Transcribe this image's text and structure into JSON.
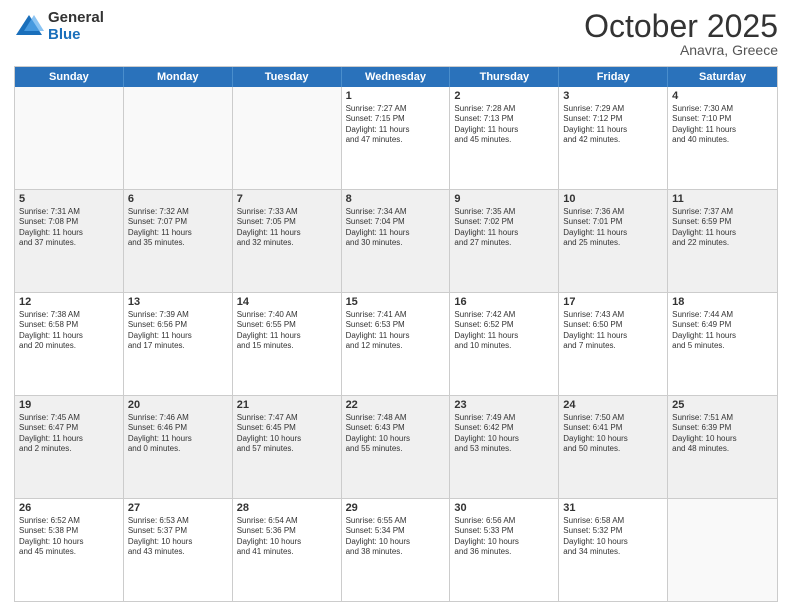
{
  "header": {
    "logo_line1": "General",
    "logo_line2": "Blue",
    "month": "October 2025",
    "location": "Anavra, Greece"
  },
  "days": [
    "Sunday",
    "Monday",
    "Tuesday",
    "Wednesday",
    "Thursday",
    "Friday",
    "Saturday"
  ],
  "rows": [
    [
      {
        "day": "",
        "info": ""
      },
      {
        "day": "",
        "info": ""
      },
      {
        "day": "",
        "info": ""
      },
      {
        "day": "1",
        "info": "Sunrise: 7:27 AM\nSunset: 7:15 PM\nDaylight: 11 hours\nand 47 minutes."
      },
      {
        "day": "2",
        "info": "Sunrise: 7:28 AM\nSunset: 7:13 PM\nDaylight: 11 hours\nand 45 minutes."
      },
      {
        "day": "3",
        "info": "Sunrise: 7:29 AM\nSunset: 7:12 PM\nDaylight: 11 hours\nand 42 minutes."
      },
      {
        "day": "4",
        "info": "Sunrise: 7:30 AM\nSunset: 7:10 PM\nDaylight: 11 hours\nand 40 minutes."
      }
    ],
    [
      {
        "day": "5",
        "info": "Sunrise: 7:31 AM\nSunset: 7:08 PM\nDaylight: 11 hours\nand 37 minutes."
      },
      {
        "day": "6",
        "info": "Sunrise: 7:32 AM\nSunset: 7:07 PM\nDaylight: 11 hours\nand 35 minutes."
      },
      {
        "day": "7",
        "info": "Sunrise: 7:33 AM\nSunset: 7:05 PM\nDaylight: 11 hours\nand 32 minutes."
      },
      {
        "day": "8",
        "info": "Sunrise: 7:34 AM\nSunset: 7:04 PM\nDaylight: 11 hours\nand 30 minutes."
      },
      {
        "day": "9",
        "info": "Sunrise: 7:35 AM\nSunset: 7:02 PM\nDaylight: 11 hours\nand 27 minutes."
      },
      {
        "day": "10",
        "info": "Sunrise: 7:36 AM\nSunset: 7:01 PM\nDaylight: 11 hours\nand 25 minutes."
      },
      {
        "day": "11",
        "info": "Sunrise: 7:37 AM\nSunset: 6:59 PM\nDaylight: 11 hours\nand 22 minutes."
      }
    ],
    [
      {
        "day": "12",
        "info": "Sunrise: 7:38 AM\nSunset: 6:58 PM\nDaylight: 11 hours\nand 20 minutes."
      },
      {
        "day": "13",
        "info": "Sunrise: 7:39 AM\nSunset: 6:56 PM\nDaylight: 11 hours\nand 17 minutes."
      },
      {
        "day": "14",
        "info": "Sunrise: 7:40 AM\nSunset: 6:55 PM\nDaylight: 11 hours\nand 15 minutes."
      },
      {
        "day": "15",
        "info": "Sunrise: 7:41 AM\nSunset: 6:53 PM\nDaylight: 11 hours\nand 12 minutes."
      },
      {
        "day": "16",
        "info": "Sunrise: 7:42 AM\nSunset: 6:52 PM\nDaylight: 11 hours\nand 10 minutes."
      },
      {
        "day": "17",
        "info": "Sunrise: 7:43 AM\nSunset: 6:50 PM\nDaylight: 11 hours\nand 7 minutes."
      },
      {
        "day": "18",
        "info": "Sunrise: 7:44 AM\nSunset: 6:49 PM\nDaylight: 11 hours\nand 5 minutes."
      }
    ],
    [
      {
        "day": "19",
        "info": "Sunrise: 7:45 AM\nSunset: 6:47 PM\nDaylight: 11 hours\nand 2 minutes."
      },
      {
        "day": "20",
        "info": "Sunrise: 7:46 AM\nSunset: 6:46 PM\nDaylight: 11 hours\nand 0 minutes."
      },
      {
        "day": "21",
        "info": "Sunrise: 7:47 AM\nSunset: 6:45 PM\nDaylight: 10 hours\nand 57 minutes."
      },
      {
        "day": "22",
        "info": "Sunrise: 7:48 AM\nSunset: 6:43 PM\nDaylight: 10 hours\nand 55 minutes."
      },
      {
        "day": "23",
        "info": "Sunrise: 7:49 AM\nSunset: 6:42 PM\nDaylight: 10 hours\nand 53 minutes."
      },
      {
        "day": "24",
        "info": "Sunrise: 7:50 AM\nSunset: 6:41 PM\nDaylight: 10 hours\nand 50 minutes."
      },
      {
        "day": "25",
        "info": "Sunrise: 7:51 AM\nSunset: 6:39 PM\nDaylight: 10 hours\nand 48 minutes."
      }
    ],
    [
      {
        "day": "26",
        "info": "Sunrise: 6:52 AM\nSunset: 5:38 PM\nDaylight: 10 hours\nand 45 minutes."
      },
      {
        "day": "27",
        "info": "Sunrise: 6:53 AM\nSunset: 5:37 PM\nDaylight: 10 hours\nand 43 minutes."
      },
      {
        "day": "28",
        "info": "Sunrise: 6:54 AM\nSunset: 5:36 PM\nDaylight: 10 hours\nand 41 minutes."
      },
      {
        "day": "29",
        "info": "Sunrise: 6:55 AM\nSunset: 5:34 PM\nDaylight: 10 hours\nand 38 minutes."
      },
      {
        "day": "30",
        "info": "Sunrise: 6:56 AM\nSunset: 5:33 PM\nDaylight: 10 hours\nand 36 minutes."
      },
      {
        "day": "31",
        "info": "Sunrise: 6:58 AM\nSunset: 5:32 PM\nDaylight: 10 hours\nand 34 minutes."
      },
      {
        "day": "",
        "info": ""
      }
    ]
  ]
}
